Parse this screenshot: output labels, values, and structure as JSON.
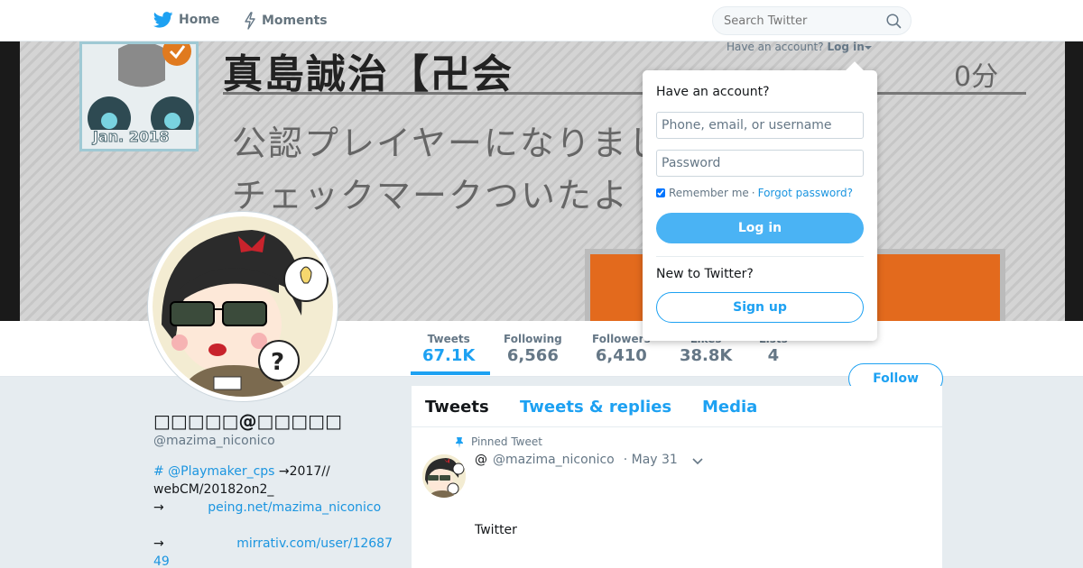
{
  "nav": {
    "home_label": "Home",
    "moments_label": "Moments",
    "search_placeholder": "Search Twitter"
  },
  "banner": {
    "title": "真島誠治【卍会",
    "line1": "公認プレイヤーになりまし",
    "line2": "チェックマークついたよ",
    "time": "0分",
    "badge_text": "Jan. 2018"
  },
  "profile_nav": {
    "stats": [
      {
        "label": "Tweets",
        "value": "67.1K"
      },
      {
        "label": "Following",
        "value": "6,566"
      },
      {
        "label": "Followers",
        "value": "6,410"
      },
      {
        "label": "Likes",
        "value": "38.8K"
      },
      {
        "label": "Lists",
        "value": "4"
      }
    ],
    "follow_label": "Follow"
  },
  "profile": {
    "name": "□□□□□@□□□□□",
    "handle": "@mazima_niconico",
    "bio_hashtag": "# @Playmaker_cps",
    "bio_text1": " →2017//",
    "bio_text2": "webCM/20182on2_",
    "bio_arrow": "→",
    "bio_link1": "peing.net/mazima_niconico",
    "bio_link2": "mirrativ.com/user/12687",
    "bio_link2_cont": "49"
  },
  "timeline": {
    "tabs": [
      "Tweets",
      "Tweets & replies",
      "Media"
    ],
    "pinned_label": "Pinned Tweet",
    "tweet": {
      "name": "@",
      "handle": "@mazima_niconico",
      "date": "· May 31",
      "text": "Twitter"
    }
  },
  "login": {
    "have_account": "Have an account?",
    "login_link": "Log in",
    "heading": "Have an account?",
    "username_placeholder": "Phone, email, or username",
    "password_placeholder": "Password",
    "remember": "Remember me",
    "separator": "·",
    "forgot": "Forgot password?",
    "login_button": "Log in",
    "new_heading": "New to Twitter?",
    "signup_button": "Sign up"
  },
  "colors": {
    "accent": "#1da1f2",
    "login_button": "#4ab3f4",
    "background": "#e6ecf0"
  }
}
